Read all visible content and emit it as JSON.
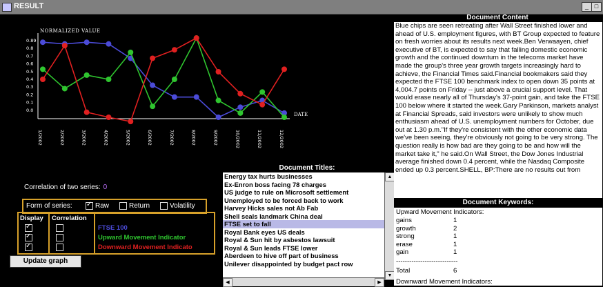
{
  "window": {
    "title": "RESULT"
  },
  "chart_data": {
    "type": "line",
    "title": "NORMALIZED VALUE",
    "xlabel": "DATE",
    "ylabel": "NORMALIZED VALUE",
    "ylim": [
      0,
      0.9
    ],
    "y_ticks": [
      "0.89",
      "0.8",
      "0.7",
      "0.6",
      "0.5",
      "0.4",
      "0.3",
      "0.2",
      "0.1",
      "0.0"
    ],
    "categories": [
      "1/2002",
      "2/2002",
      "3/2002",
      "4/2002",
      "5/2002",
      "6/2002",
      "7/2002",
      "8/2002",
      "9/2002",
      "10/2002",
      "11/2002",
      "12/2002"
    ],
    "series": [
      {
        "name": "FTSE 100",
        "color": "#4b4bd8",
        "values": [
          0.89,
          0.87,
          0.89,
          0.87,
          0.7,
          0.38,
          0.24,
          0.24,
          0.0,
          0.12,
          0.2,
          0.05
        ]
      },
      {
        "name": "Upward Movement Indicator",
        "color": "#2fc52f",
        "values": [
          0.57,
          0.34,
          0.5,
          0.45,
          0.77,
          0.13,
          0.45,
          0.94,
          0.2,
          0.05,
          0.3,
          0.0
        ]
      },
      {
        "name": "Downward Movement Indicator",
        "color": "#e02020",
        "values": [
          0.45,
          0.85,
          0.06,
          0.0,
          -0.05,
          0.7,
          0.8,
          0.94,
          0.54,
          0.28,
          0.15,
          0.57
        ]
      }
    ],
    "grid": false,
    "legend": "bottom-left"
  },
  "controls": {
    "correlation_label": "Correlation of two series:",
    "correlation_value": "0",
    "form_label": "Form of series:",
    "form_options": [
      {
        "label": "Raw",
        "checked": true
      },
      {
        "label": "Return",
        "checked": false
      },
      {
        "label": "Volatility",
        "checked": false
      }
    ],
    "display_header": "Display",
    "correlation_header": "Correlation",
    "series": [
      {
        "name": "FTSE 100",
        "display": true,
        "correlation": false,
        "color": "#4b4bd8"
      },
      {
        "name": "Upward Movement Indicator",
        "display": true,
        "correlation": false,
        "color": "#2fc52f"
      },
      {
        "name": "Downward Movement Indicato",
        "display": true,
        "correlation": false,
        "color": "#e02020"
      }
    ],
    "update_button": "Update graph"
  },
  "titles": {
    "header": "Document Titles:",
    "items": [
      "Energy tax hurts businesses",
      "Ex-Enron boss facing 78 charges",
      "US judge to rule on Microsoft settlement",
      "Unemployed to be forced back to work",
      "Harvey Hicks sales not Ab Fab",
      "Shell seals landmark China deal",
      "FTSE set to fall",
      "Royal Bank eyes US deals",
      "Royal & Sun hit by asbestos lawsuit",
      "Royal & Sun leads FTSE lower",
      "Aberdeen to hive off part of business",
      "Unilever disappointed by budget pact row"
    ],
    "selected_index": 6
  },
  "document": {
    "header": "Document Content",
    "text": "Blue chips are seen retreating after Wall Street finished lower and ahead of U.S. employment figures, with BT Group expected to feature on fresh worries about its results next week.Ben Verwaayen, chief executive of BT, is expected to say that falling domestic economic growth and the continued downturn in the telecoms market have made the group's three year growth targets increasingly hard to achieve, the Financial Times said.Financial bookmakers said they expected the FTSE 100 benchmark index to open down 35 points at 4,004.7 points on Friday -- just above a crucial support level. That would erase nearly all of Thursday's 37-point gain, and take the FTSE 100 below where it started the week.Gary Parkinson, markets analyst at Financial Spreads, said investors were unlikely to show much enthusiasm ahead of U.S. unemployment numbers for October, due out at 1.30 p.m.\"If they're consistent with the other economic data we've been seeing, they're obviously not going to be very strong. The question really is how bad are they going to be and how will the market take it,\" he said.On Wall Street, the Dow Jones Industrial average finished down 0.4 percent, while the Nasdaq Composite ended up 0.3 percent.SHELL, BP:There are no results out from"
  },
  "keywords": {
    "header": "Document Keywords:",
    "upward_title": "Upward Movement Indicators:",
    "upward": [
      {
        "word": "gains",
        "count": "1"
      },
      {
        "word": "growth",
        "count": "2"
      },
      {
        "word": "strong",
        "count": "1"
      },
      {
        "word": "erase",
        "count": "1"
      },
      {
        "word": "gain",
        "count": "1"
      }
    ],
    "separator": "----------------------------",
    "total_label": "Total",
    "total_value": "6",
    "downward_title": "Downward Movement Indicators:"
  }
}
